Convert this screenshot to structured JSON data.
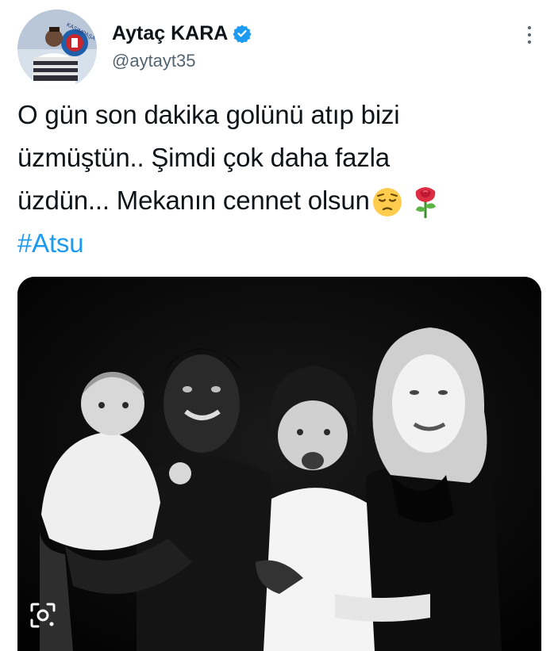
{
  "author": {
    "display_name": "Aytaç KARA",
    "handle": "@aytayt35",
    "verified": true,
    "verified_icon": "verified-badge-icon",
    "avatar_text": "KASIMPAŞA"
  },
  "tweet": {
    "lines": [
      "O gün son dakika golünü atıp bizi",
      "üzmüştün.. Şimdi çok daha fazla",
      "üzdün... Mekanın cennet olsun"
    ],
    "emojis": [
      "pensive-face-emoji",
      "rose-emoji"
    ],
    "hashtag": "#Atsu"
  },
  "media": {
    "type": "black-and-white-family-photo",
    "overlay_icon": "visual-search-icon"
  },
  "menu_icon": "more-options-icon",
  "colors": {
    "text": "#0f1419",
    "secondary": "#536471",
    "link": "#1d9bf0",
    "verified": "#1d9bf0"
  }
}
